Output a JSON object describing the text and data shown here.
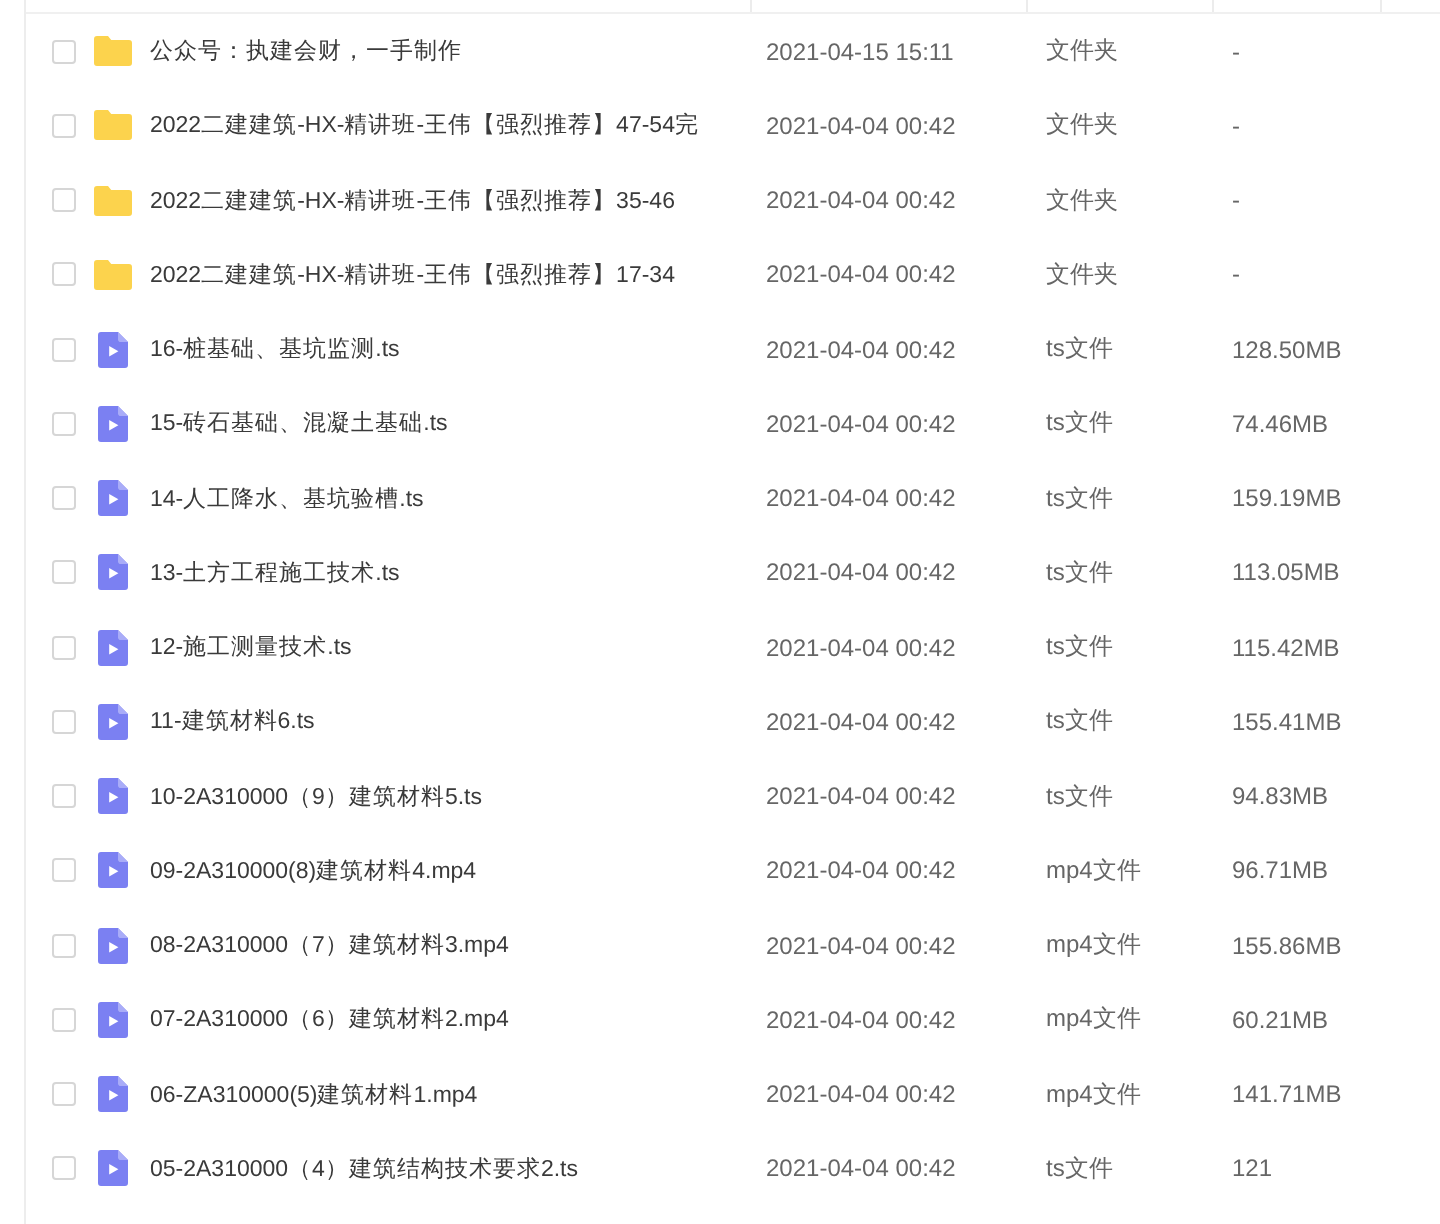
{
  "table": {
    "rows": [
      {
        "kind": "folder",
        "checked": false,
        "name": "公众号：执建会财，一手制作",
        "modified": "2021-04-15 15:11",
        "type": "文件夹",
        "size": "-"
      },
      {
        "kind": "folder",
        "checked": false,
        "name": "2022二建建筑-HX-精讲班-王伟【强烈推荐】47-54完",
        "modified": "2021-04-04 00:42",
        "type": "文件夹",
        "size": "-"
      },
      {
        "kind": "folder",
        "checked": false,
        "name": "2022二建建筑-HX-精讲班-王伟【强烈推荐】35-46",
        "modified": "2021-04-04 00:42",
        "type": "文件夹",
        "size": "-"
      },
      {
        "kind": "folder",
        "checked": false,
        "name": "2022二建建筑-HX-精讲班-王伟【强烈推荐】17-34",
        "modified": "2021-04-04 00:42",
        "type": "文件夹",
        "size": "-"
      },
      {
        "kind": "video",
        "checked": false,
        "name": "16-桩基础、基坑监测.ts",
        "modified": "2021-04-04 00:42",
        "type": "ts文件",
        "size": "128.50MB"
      },
      {
        "kind": "video",
        "checked": false,
        "name": "15-砖石基础、混凝土基础.ts",
        "modified": "2021-04-04 00:42",
        "type": "ts文件",
        "size": "74.46MB"
      },
      {
        "kind": "video",
        "checked": false,
        "name": "14-人工降水、基坑验槽.ts",
        "modified": "2021-04-04 00:42",
        "type": "ts文件",
        "size": "159.19MB"
      },
      {
        "kind": "video",
        "checked": false,
        "name": "13-土方工程施工技术.ts",
        "modified": "2021-04-04 00:42",
        "type": "ts文件",
        "size": "113.05MB"
      },
      {
        "kind": "video",
        "checked": false,
        "name": "12-施工测量技术.ts",
        "modified": "2021-04-04 00:42",
        "type": "ts文件",
        "size": "115.42MB"
      },
      {
        "kind": "video",
        "checked": false,
        "name": "11-建筑材料6.ts",
        "modified": "2021-04-04 00:42",
        "type": "ts文件",
        "size": "155.41MB"
      },
      {
        "kind": "video",
        "checked": false,
        "name": "10-2A310000（9）建筑材料5.ts",
        "modified": "2021-04-04 00:42",
        "type": "ts文件",
        "size": "94.83MB"
      },
      {
        "kind": "video",
        "checked": false,
        "name": "09-2A310000(8)建筑材料4.mp4",
        "modified": "2021-04-04 00:42",
        "type": "mp4文件",
        "size": "96.71MB"
      },
      {
        "kind": "video",
        "checked": false,
        "name": "08-2A310000（7）建筑材料3.mp4",
        "modified": "2021-04-04 00:42",
        "type": "mp4文件",
        "size": "155.86MB"
      },
      {
        "kind": "video",
        "checked": false,
        "name": "07-2A310000（6）建筑材料2.mp4",
        "modified": "2021-04-04 00:42",
        "type": "mp4文件",
        "size": "60.21MB"
      },
      {
        "kind": "video",
        "checked": false,
        "name": "06-ZA310000(5)建筑材料1.mp4",
        "modified": "2021-04-04 00:42",
        "type": "mp4文件",
        "size": "141.71MB"
      },
      {
        "kind": "video",
        "checked": false,
        "name": "05-2A310000（4）建筑结构技术要求2.ts",
        "modified": "2021-04-04 00:42",
        "type": "ts文件",
        "size": "121"
      }
    ]
  }
}
